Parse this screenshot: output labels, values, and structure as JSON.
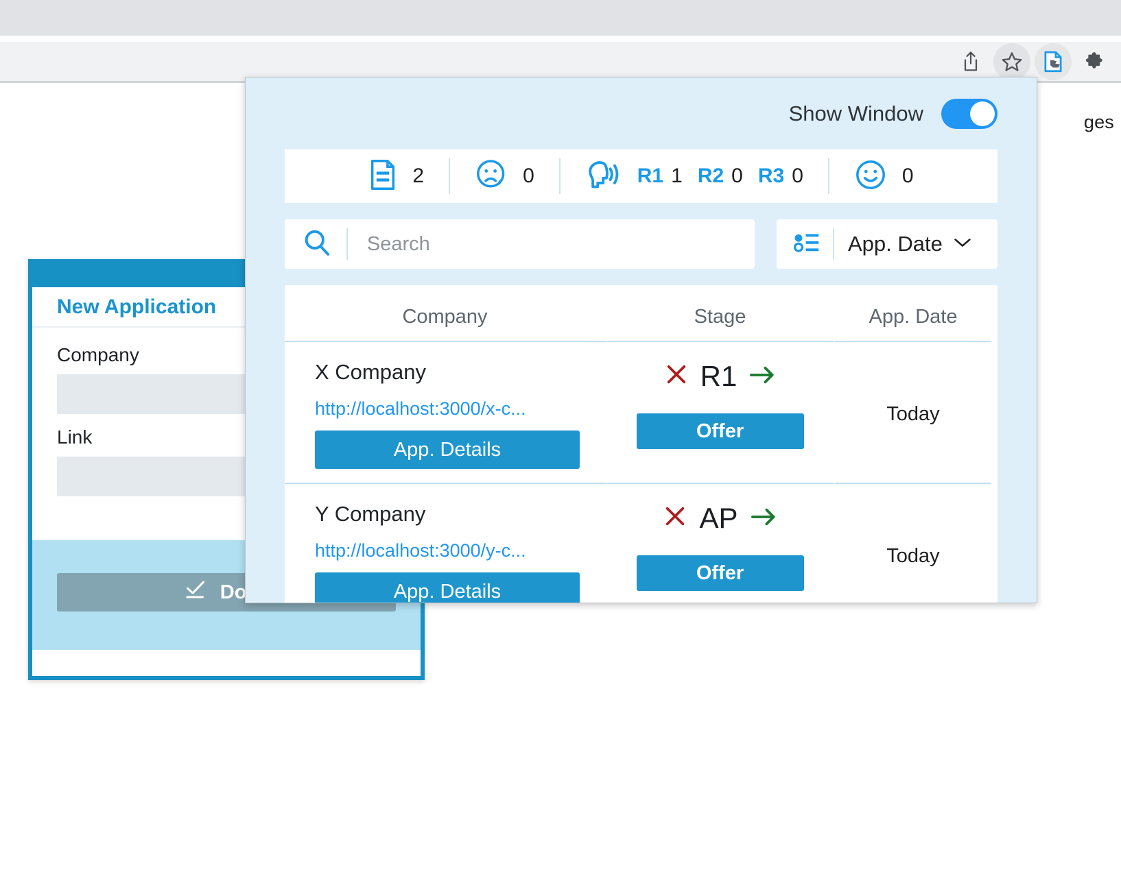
{
  "browser": {
    "toolbar_icons": [
      {
        "name": "share-icon",
        "label": "Share"
      },
      {
        "name": "bookmark-star-icon",
        "label": "Bookmark this tab"
      },
      {
        "name": "extension-app-icon",
        "label": "Job Application Tracker"
      },
      {
        "name": "extensions-puzzle-icon",
        "label": "Extensions"
      }
    ]
  },
  "page": {
    "partial_text": "ges"
  },
  "dialog": {
    "title": "New Application",
    "fields": [
      {
        "label": "Company",
        "value": "",
        "placeholder": ""
      },
      {
        "label": "Link",
        "value": "",
        "placeholder": ""
      }
    ],
    "done_label": "Done",
    "done_icon": "check-underline-icon"
  },
  "panel": {
    "show_window": {
      "label": "Show Window",
      "enabled": true,
      "accent": "#2196f3"
    },
    "stats": [
      {
        "icon": "document-icon",
        "name": "applications",
        "value": "2"
      },
      {
        "icon": "sad-face-tear-icon",
        "name": "rejections",
        "value": "0"
      },
      {
        "icon": "head-speaking-icon",
        "name": "interviews",
        "rounds": [
          {
            "label": "R1",
            "value": "1"
          },
          {
            "label": "R2",
            "value": "0"
          },
          {
            "label": "R3",
            "value": "0"
          }
        ]
      },
      {
        "icon": "smiley-face-icon",
        "name": "offers",
        "value": "0"
      }
    ],
    "search": {
      "placeholder": "Search",
      "value": "",
      "icon": "search-icon"
    },
    "sort": {
      "icon": "sort-list-icon",
      "selected": "App. Date",
      "chevron": "chevron-down-icon"
    },
    "table": {
      "headers": [
        "Company",
        "Stage",
        "App. Date"
      ],
      "rows": [
        {
          "company": "X Company",
          "link": "http://localhost:3000/x-c...",
          "details_label": "App. Details",
          "stage": "R1",
          "reject_icon": "reject-x-icon",
          "advance_icon": "advance-arrow-icon",
          "action_label": "Offer",
          "date": "Today"
        },
        {
          "company": "Y Company",
          "link": "http://localhost:3000/y-c...",
          "details_label": "App. Details",
          "stage": "AP",
          "reject_icon": "reject-x-icon",
          "advance_icon": "advance-arrow-icon",
          "action_label": "Offer",
          "date": "Today"
        }
      ]
    }
  }
}
